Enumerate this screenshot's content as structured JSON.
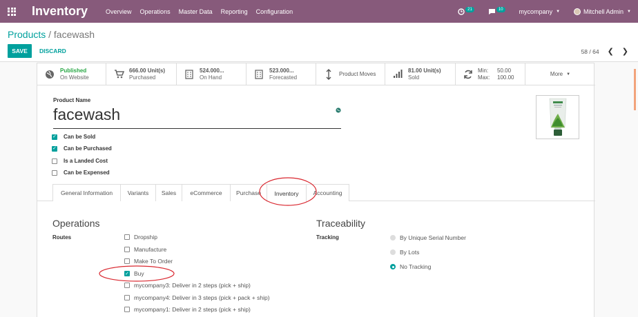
{
  "navbar": {
    "brand": "Inventory",
    "menu": [
      "Overview",
      "Operations",
      "Master Data",
      "Reporting",
      "Configuration"
    ],
    "activity_count": "21",
    "message_count": "10",
    "company": "mycompany",
    "user": "Mitchell Admin"
  },
  "control": {
    "breadcrumb_parent": "Products",
    "breadcrumb_sep": "/",
    "breadcrumb_current": "facewash",
    "save_label": "SAVE",
    "discard_label": "DISCARD",
    "pager_value": "58 / 64"
  },
  "smart_buttons": {
    "published_1": "Published",
    "published_2": "On Website",
    "purchased_1": "666.00 Unit(s)",
    "purchased_2": "Purchased",
    "onhand_1": "524.000...",
    "onhand_2": "On Hand",
    "forecasted_1": "523.000...",
    "forecasted_2": "Forecasted",
    "moves": "Product Moves",
    "sold_1": "81.00 Unit(s)",
    "sold_2": "Sold",
    "min_label": "Min:",
    "min_value": "50.00",
    "max_label": "Max:",
    "max_value": "100.00",
    "more": "More"
  },
  "form": {
    "name_label": "Product Name",
    "name_value": "facewash",
    "checkboxes": [
      {
        "label": "Can be Sold",
        "checked": true
      },
      {
        "label": "Can be Purchased",
        "checked": true
      },
      {
        "label": "Is a Landed Cost",
        "checked": false
      },
      {
        "label": "Can be Expensed",
        "checked": false
      }
    ],
    "tabs": [
      "General Information",
      "Variants",
      "Sales",
      "eCommerce",
      "Purchase",
      "Inventory",
      "Accounting"
    ],
    "active_tab": "Inventory"
  },
  "operations": {
    "title": "Operations",
    "routes_label": "Routes",
    "routes": [
      {
        "label": "Dropship",
        "checked": false
      },
      {
        "label": "Manufacture",
        "checked": false
      },
      {
        "label": "Make To Order",
        "checked": false
      },
      {
        "label": "Buy",
        "checked": true
      },
      {
        "label": "mycompany3: Deliver in 2 steps (pick + ship)",
        "checked": false
      },
      {
        "label": "mycompany4: Deliver in 3 steps (pick + pack + ship)",
        "checked": false
      },
      {
        "label": "mycompany1: Deliver in 2 steps (pick + ship)",
        "checked": false
      }
    ]
  },
  "traceability": {
    "title": "Traceability",
    "tracking_label": "Tracking",
    "options": [
      {
        "label": "By Unique Serial Number",
        "selected": false
      },
      {
        "label": "By Lots",
        "selected": false
      },
      {
        "label": "No Tracking",
        "selected": true
      }
    ]
  },
  "colors": {
    "navbar": "#875a7b",
    "accent": "#00a09d",
    "annotation": "#d9262e"
  }
}
